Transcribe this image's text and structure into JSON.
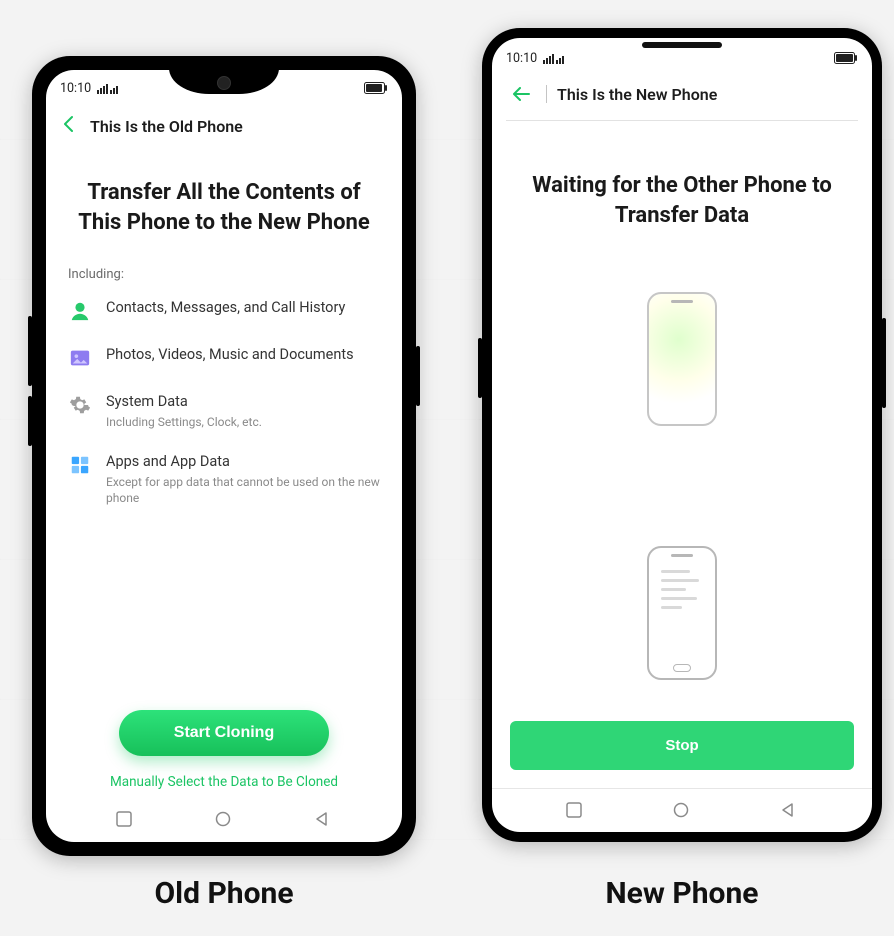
{
  "captions": {
    "old": "Old Phone",
    "new": "New Phone"
  },
  "colors": {
    "accent": "#1bc464",
    "primary": "#2fd676"
  },
  "old_phone": {
    "status": {
      "time": "10:10"
    },
    "header": {
      "title": "This Is the Old Phone"
    },
    "title": "Transfer All the Contents of This Phone to the New Phone",
    "including_label": "Including:",
    "items": [
      {
        "icon": "contact-icon",
        "title": "Contacts, Messages, and Call History",
        "sub": ""
      },
      {
        "icon": "media-icon",
        "title": "Photos, Videos, Music and Documents",
        "sub": ""
      },
      {
        "icon": "gear-icon",
        "title": "System Data",
        "sub": "Including Settings, Clock, etc."
      },
      {
        "icon": "apps-icon",
        "title": "Apps and App Data",
        "sub": "Except for app data that cannot be used on the new phone"
      }
    ],
    "primary_button": "Start Cloning",
    "secondary_link": "Manually Select the Data to Be Cloned"
  },
  "new_phone": {
    "status": {
      "time": "10:10"
    },
    "header": {
      "title": "This Is the New Phone"
    },
    "title": "Waiting for the Other Phone to Transfer Data",
    "stop_button": "Stop"
  }
}
